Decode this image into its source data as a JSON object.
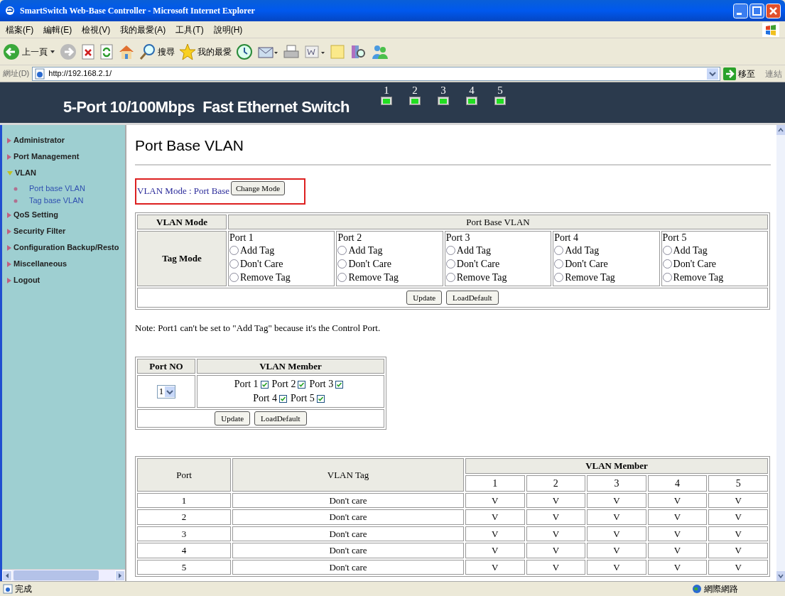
{
  "window": {
    "title": "SmartSwitch Web-Base Controller - Microsoft Internet Explorer"
  },
  "menu": [
    "檔案(F)",
    "編輯(E)",
    "檢視(V)",
    "我的最愛(A)",
    "工具(T)",
    "說明(H)"
  ],
  "toolbar": {
    "back": "上一頁",
    "search": "搜尋",
    "favorites": "我的最愛"
  },
  "address": {
    "label": "網址(D)",
    "value": "http://192.168.2.1/",
    "go": "移至",
    "links": "連結"
  },
  "banner": {
    "title": "5-Port 10/100Mbps  Fast Ethernet Switch",
    "ports": [
      {
        "label": "1"
      },
      {
        "label": "2"
      },
      {
        "label": "3"
      },
      {
        "label": "4"
      },
      {
        "label": "5"
      }
    ]
  },
  "sidebar": {
    "items": [
      {
        "label": "Administrator"
      },
      {
        "label": "Port Management"
      },
      {
        "label": "VLAN",
        "expanded": true,
        "children": [
          {
            "label": "Port base VLAN"
          },
          {
            "label": "Tag base VLAN"
          }
        ]
      },
      {
        "label": "QoS Setting"
      },
      {
        "label": "Security Filter"
      },
      {
        "label": "Configuration Backup/Resto"
      },
      {
        "label": "Miscellaneous"
      },
      {
        "label": "Logout"
      }
    ]
  },
  "heading": "Port Base VLAN",
  "mode": {
    "label": "VLAN Mode : Port Base",
    "button": "Change Mode"
  },
  "tag_table": {
    "corner": "VLAN Mode",
    "header": "Port Base VLAN",
    "row_label": "Tag Mode",
    "ports": [
      {
        "name": "Port 1",
        "options": [
          {
            "label": "Add Tag",
            "selected": false
          },
          {
            "label": "Don't Care",
            "selected": false
          },
          {
            "label": "Remove Tag",
            "selected": false
          }
        ]
      },
      {
        "name": "Port 2",
        "options": [
          {
            "label": "Add Tag",
            "selected": false
          },
          {
            "label": "Don't Care",
            "selected": false
          },
          {
            "label": "Remove Tag",
            "selected": false
          }
        ]
      },
      {
        "name": "Port 3",
        "options": [
          {
            "label": "Add Tag",
            "selected": false
          },
          {
            "label": "Don't Care",
            "selected": false
          },
          {
            "label": "Remove Tag",
            "selected": false
          }
        ]
      },
      {
        "name": "Port 4",
        "options": [
          {
            "label": "Add Tag",
            "selected": false
          },
          {
            "label": "Don't Care",
            "selected": false
          },
          {
            "label": "Remove Tag",
            "selected": false
          }
        ]
      },
      {
        "name": "Port 5",
        "options": [
          {
            "label": "Add Tag",
            "selected": false
          },
          {
            "label": "Don't Care",
            "selected": false
          },
          {
            "label": "Remove Tag",
            "selected": false
          }
        ]
      }
    ],
    "buttons": [
      "Update",
      "LoadDefault"
    ]
  },
  "note": "Note: Port1 can't be set to \"Add Tag\" because it's the Control Port.",
  "member_table": {
    "columns": [
      "Port NO",
      "VLAN Member"
    ],
    "port_select": "1",
    "members": [
      {
        "label": "Port 1",
        "checked": true
      },
      {
        "label": "Port 2",
        "checked": true
      },
      {
        "label": "Port 3",
        "checked": true
      },
      {
        "label": "Port 4",
        "checked": true
      },
      {
        "label": "Port 5",
        "checked": true
      }
    ],
    "buttons": [
      "Update",
      "LoadDefault"
    ]
  },
  "summary_table": {
    "columns": [
      "Port",
      "VLAN Tag",
      "VLAN Member"
    ],
    "member_columns": [
      "1",
      "2",
      "3",
      "4",
      "5"
    ],
    "rows": [
      {
        "port": "1",
        "tag": "Don't care",
        "members": [
          "V",
          "V",
          "V",
          "V",
          "V"
        ]
      },
      {
        "port": "2",
        "tag": "Don't care",
        "members": [
          "V",
          "V",
          "V",
          "V",
          "V"
        ]
      },
      {
        "port": "3",
        "tag": "Don't care",
        "members": [
          "V",
          "V",
          "V",
          "V",
          "V"
        ]
      },
      {
        "port": "4",
        "tag": "Don't care",
        "members": [
          "V",
          "V",
          "V",
          "V",
          "V"
        ]
      },
      {
        "port": "5",
        "tag": "Don't care",
        "members": [
          "V",
          "V",
          "V",
          "V",
          "V"
        ]
      }
    ]
  },
  "status_bar": {
    "text": "完成",
    "zone": "網際網路"
  }
}
